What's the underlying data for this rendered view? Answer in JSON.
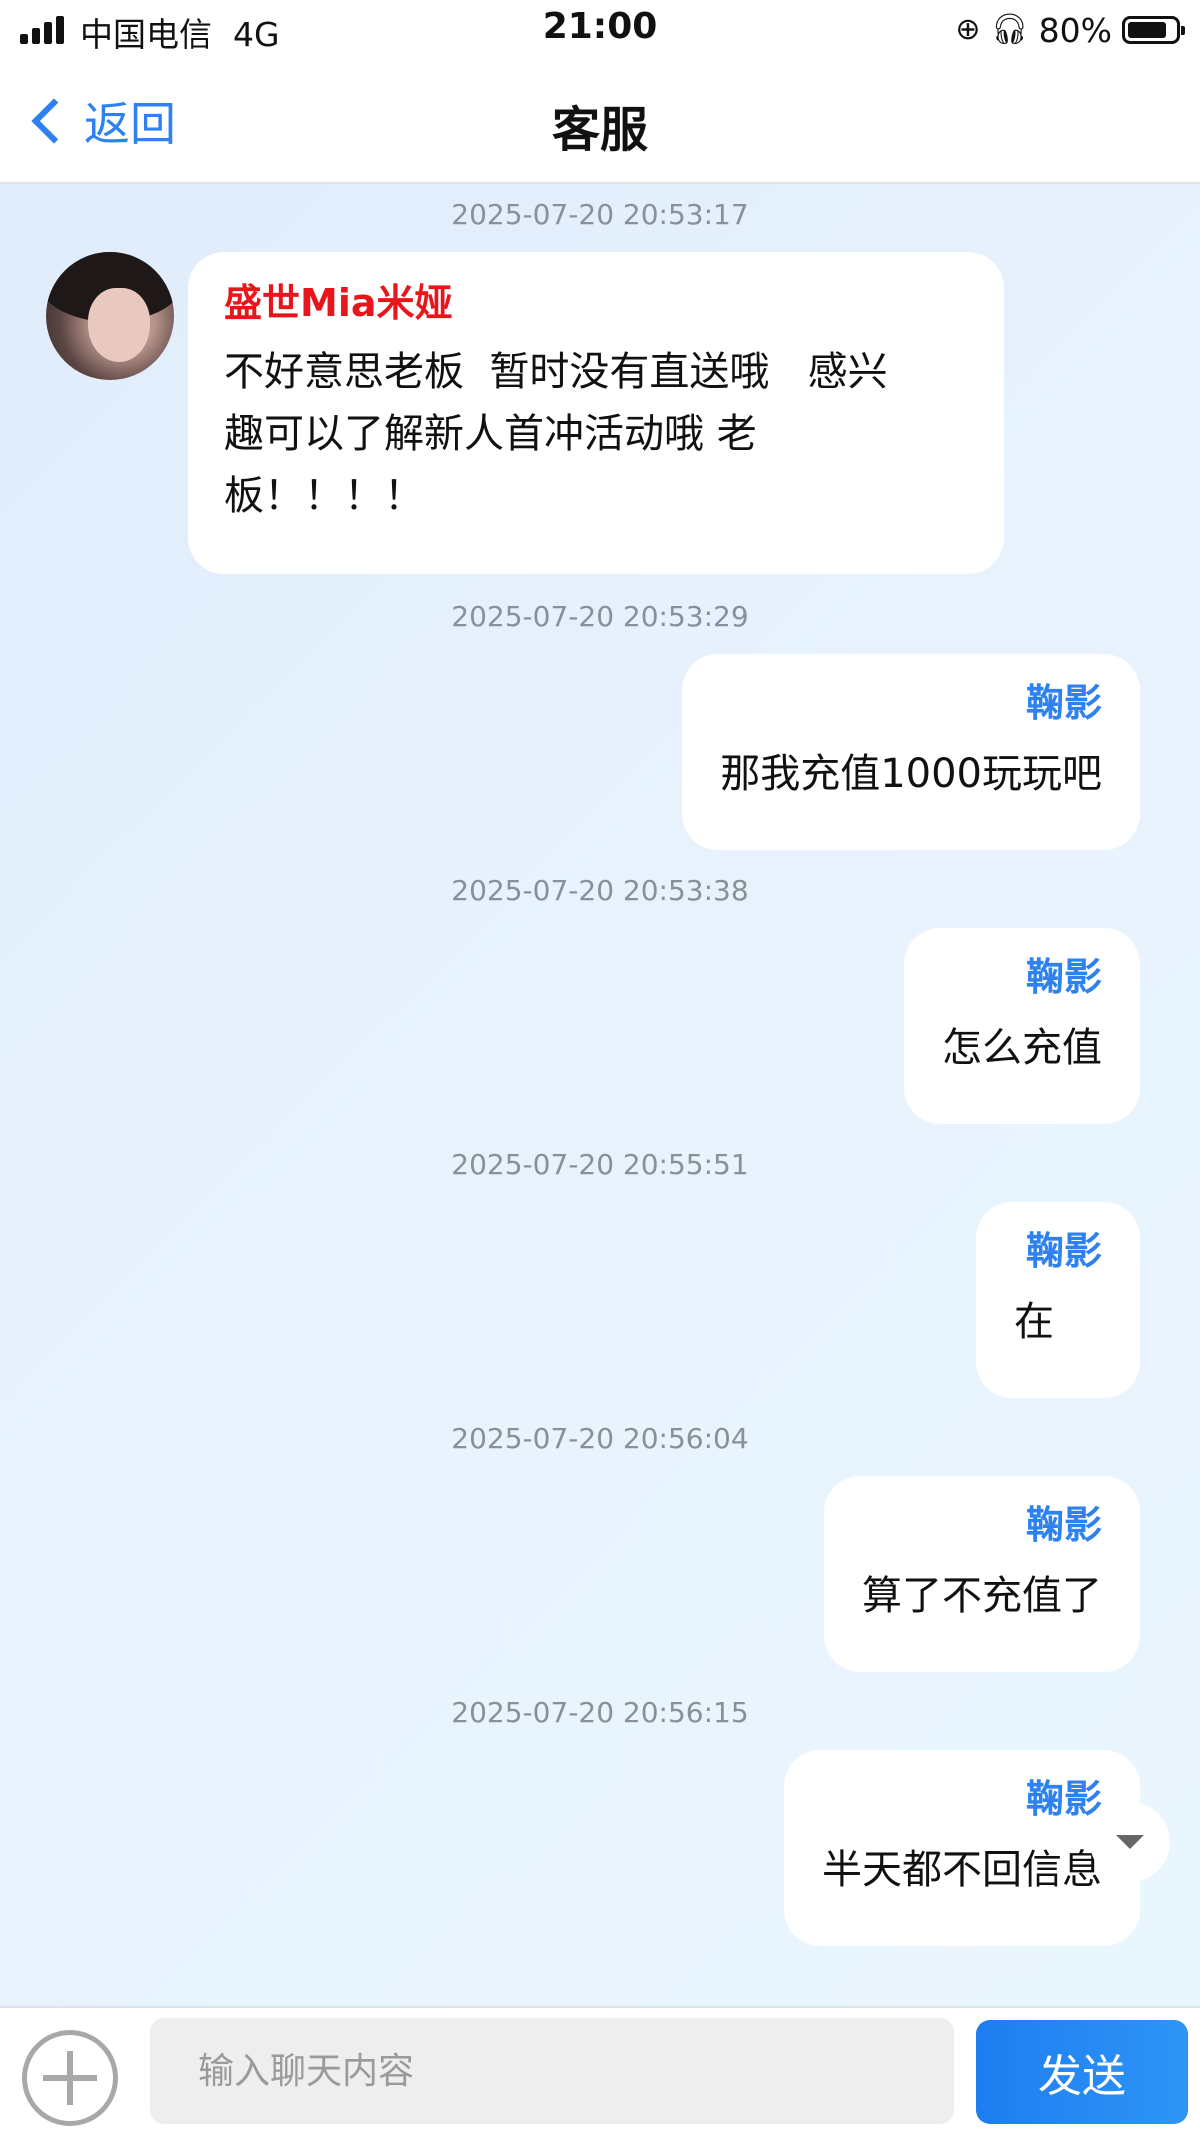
{
  "status_bar": {
    "carrier": "中国电信",
    "network": "4G",
    "time": "21:00",
    "battery": "80%"
  },
  "nav": {
    "back_label": "返回",
    "title": "客服"
  },
  "messages": [
    {
      "timestamp": "2025-07-20 20:53:17",
      "side": "left",
      "sender": "盛世Mia米娅",
      "lines": [
        "不好意思老板  暂时没有直送哦   感兴",
        "趣可以了解新人首冲活动哦 老",
        "板！！！！"
      ]
    },
    {
      "timestamp": "2025-07-20 20:53:29",
      "side": "right",
      "sender": "鞠影",
      "text": "那我充值1000玩玩吧"
    },
    {
      "timestamp": "2025-07-20 20:53:38",
      "side": "right",
      "sender": "鞠影",
      "text": "怎么充值"
    },
    {
      "timestamp": "2025-07-20 20:55:51",
      "side": "right",
      "sender": "鞠影",
      "text": "在"
    },
    {
      "timestamp": "2025-07-20 20:56:04",
      "side": "right",
      "sender": "鞠影",
      "text": "算了不充值了"
    },
    {
      "timestamp": "2025-07-20 20:56:15",
      "side": "right",
      "sender": "鞠影",
      "text": "半天都不回信息"
    }
  ],
  "input": {
    "placeholder": "输入聊天内容",
    "value": "",
    "send_label": "发送"
  },
  "icons": {
    "back": "chevron-left-icon",
    "add": "plus-circle-icon",
    "scroll": "caret-down-icon"
  },
  "colors": {
    "accent": "#2d82f0",
    "agent_name": "#e8161b",
    "timestamp": "#8a8f99"
  }
}
